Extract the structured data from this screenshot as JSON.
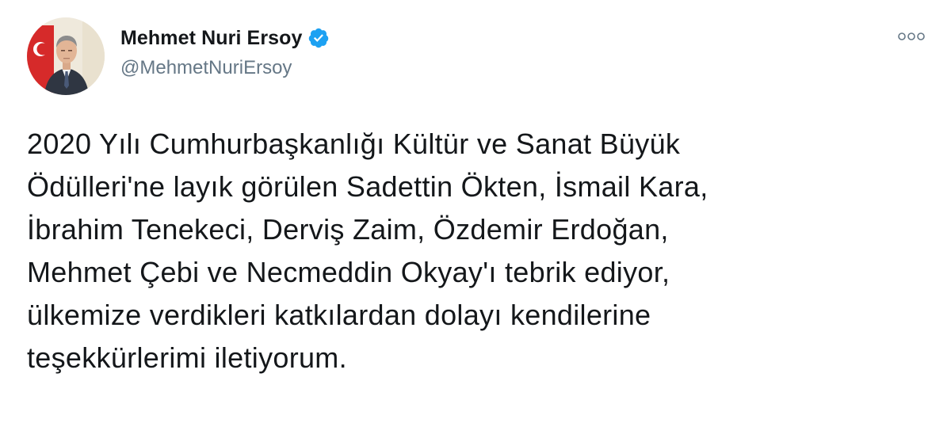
{
  "author": {
    "display_name": "Mehmet Nuri Ersoy",
    "handle": "@MehmetNuriErsoy",
    "verified": true,
    "verified_icon": "verified-badge-icon",
    "avatar_icon": "profile-photo-avatar"
  },
  "more_icon": "more-options-icon",
  "tweet": {
    "text_lines": [
      "2020 Yılı Cumhurbaşkanlığı Kültür ve Sanat Büyük",
      "Ödülleri'ne layık görülen Sadettin Ökten, İsmail Kara,",
      "İbrahim Tenekeci, Derviş Zaim, Özdemir Erdoğan,",
      "Mehmet Çebi ve Necmeddin Okyay'ı tebrik ediyor,",
      "ülkemize verdikleri katkılardan dolayı kendilerine",
      "teşekkürlerimi iletiyorum."
    ]
  },
  "colors": {
    "text": "#14171a",
    "secondary_text": "#657786",
    "verified_blue": "#1da1f2",
    "background": "#ffffff"
  }
}
